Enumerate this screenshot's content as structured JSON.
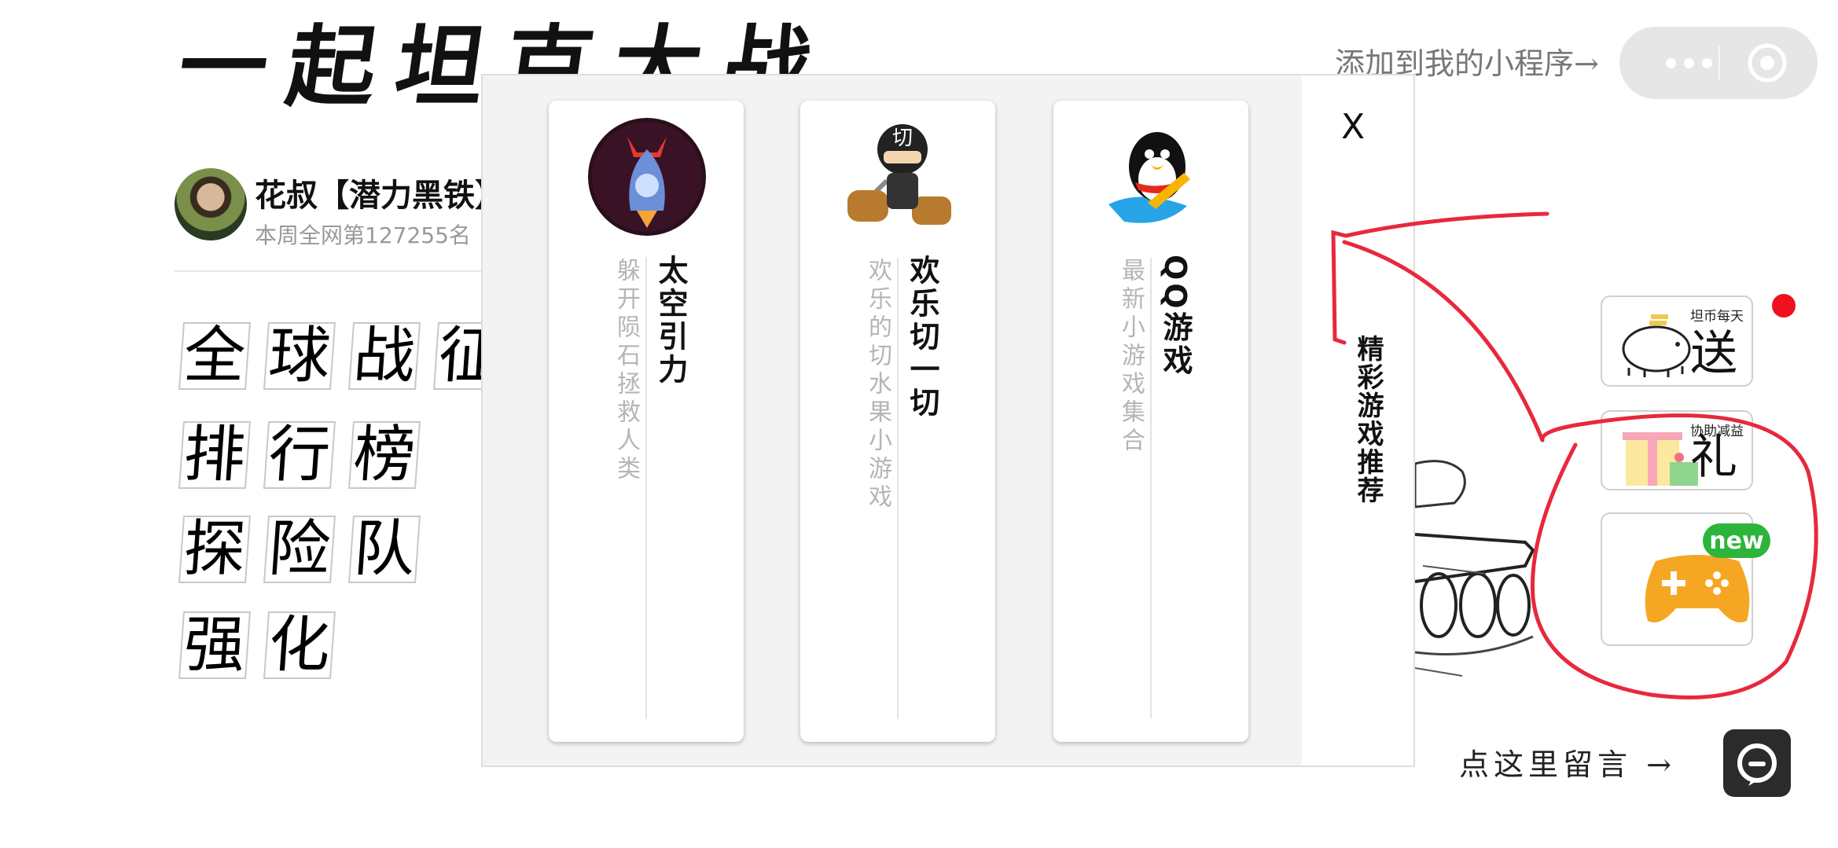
{
  "page": {
    "title": "一起坦克大战",
    "add_hint": "添加到我的小程序→",
    "user_name": "花叔【潜力黑铁】",
    "user_rank": "本周全网第127255名",
    "menu_rows": [
      [
        "全",
        "球",
        "战",
        "征"
      ],
      [
        "排",
        "行",
        "榜"
      ],
      [
        "探",
        "险",
        "队"
      ],
      [
        "强",
        "化"
      ]
    ],
    "side_buttons": {
      "coin_small": "坦币每天",
      "coin_big": "送",
      "gift_small": "协助减益",
      "gift_big": "礼",
      "new_badge": "new"
    },
    "message_hint": "点这里留言 →"
  },
  "modal": {
    "close_label": "X",
    "side_title": "精彩游戏推荐",
    "games": [
      {
        "name": "太空引力",
        "desc": "躲开陨石拯救人类"
      },
      {
        "name": "欢乐切一切",
        "desc": "欢乐的切水果小游戏"
      },
      {
        "name": "QQ游戏",
        "desc": "最新小游戏集合"
      }
    ]
  },
  "icons": [
    "more-dots-icon",
    "target-icon",
    "piggy-bank-icon",
    "gift-icon",
    "gamepad-icon",
    "message-icon",
    "rocket-icon",
    "ninja-icon",
    "qq-penguin-icon"
  ],
  "colors": {
    "scribble": "#e8283c",
    "new_badge": "#2cb53a",
    "red_dot": "#f0101e",
    "gamepad": "#f5a623"
  }
}
